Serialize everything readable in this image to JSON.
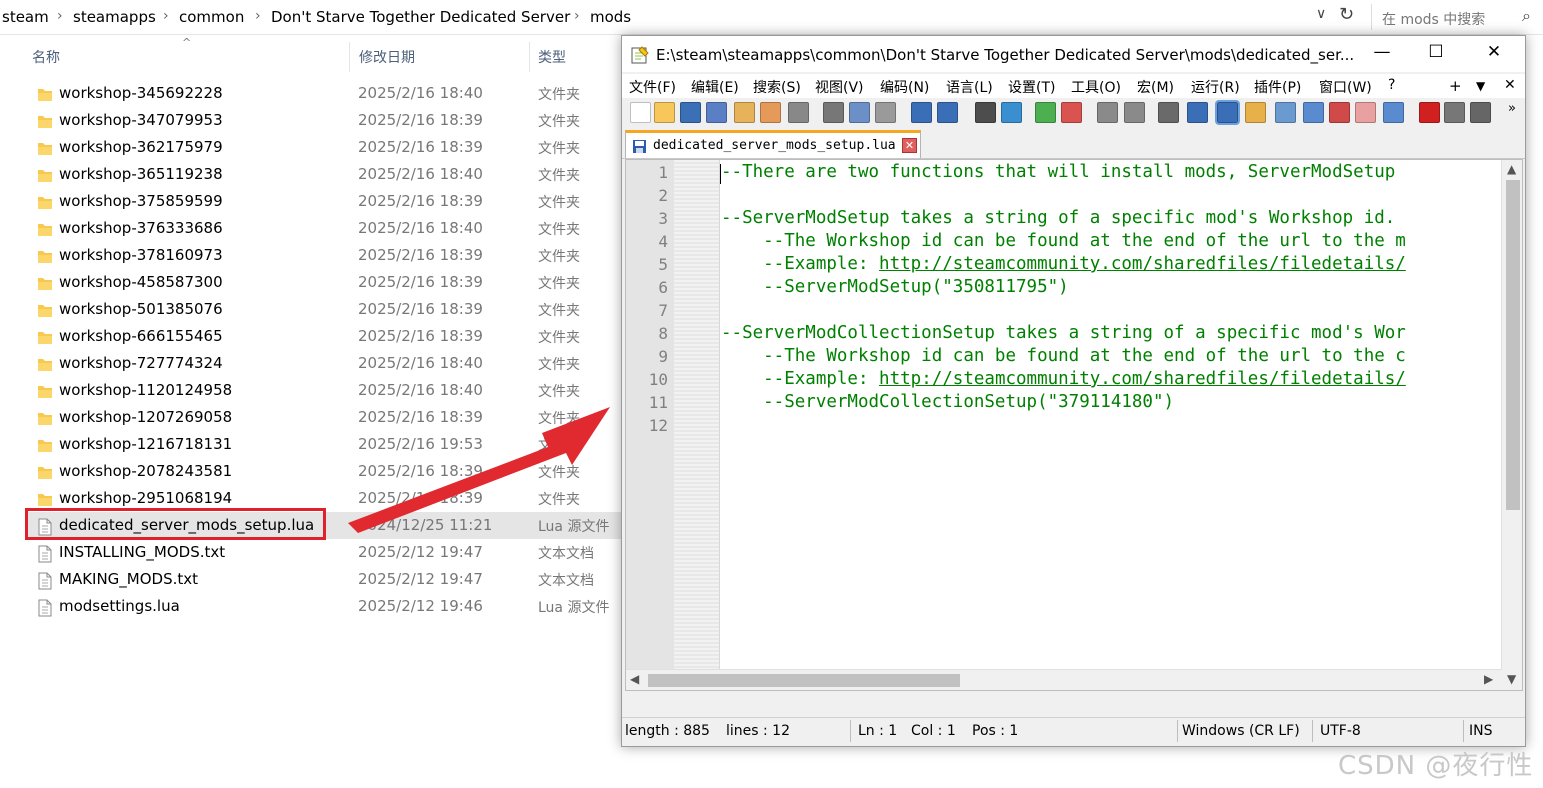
{
  "explorer": {
    "breadcrumb": [
      "steam",
      "steamapps",
      "common",
      "Don't Starve Together Dedicated Server",
      "mods"
    ],
    "search_placeholder": "在 mods 中搜索",
    "columns": {
      "name": "名称",
      "date": "修改日期",
      "type": "类型"
    },
    "files": [
      {
        "name": "workshop-345692228",
        "date": "2025/2/16 18:40",
        "type": "文件夹",
        "kind": "folder"
      },
      {
        "name": "workshop-347079953",
        "date": "2025/2/16 18:39",
        "type": "文件夹",
        "kind": "folder"
      },
      {
        "name": "workshop-362175979",
        "date": "2025/2/16 18:39",
        "type": "文件夹",
        "kind": "folder"
      },
      {
        "name": "workshop-365119238",
        "date": "2025/2/16 18:40",
        "type": "文件夹",
        "kind": "folder"
      },
      {
        "name": "workshop-375859599",
        "date": "2025/2/16 18:39",
        "type": "文件夹",
        "kind": "folder"
      },
      {
        "name": "workshop-376333686",
        "date": "2025/2/16 18:40",
        "type": "文件夹",
        "kind": "folder"
      },
      {
        "name": "workshop-378160973",
        "date": "2025/2/16 18:39",
        "type": "文件夹",
        "kind": "folder"
      },
      {
        "name": "workshop-458587300",
        "date": "2025/2/16 18:39",
        "type": "文件夹",
        "kind": "folder"
      },
      {
        "name": "workshop-501385076",
        "date": "2025/2/16 18:39",
        "type": "文件夹",
        "kind": "folder"
      },
      {
        "name": "workshop-666155465",
        "date": "2025/2/16 18:39",
        "type": "文件夹",
        "kind": "folder"
      },
      {
        "name": "workshop-727774324",
        "date": "2025/2/16 18:40",
        "type": "文件夹",
        "kind": "folder"
      },
      {
        "name": "workshop-1120124958",
        "date": "2025/2/16 18:40",
        "type": "文件夹",
        "kind": "folder"
      },
      {
        "name": "workshop-1207269058",
        "date": "2025/2/16 18:39",
        "type": "文件夹",
        "kind": "folder"
      },
      {
        "name": "workshop-1216718131",
        "date": "2025/2/16 19:53",
        "type": "文件夹",
        "kind": "folder"
      },
      {
        "name": "workshop-2078243581",
        "date": "2025/2/16 18:39",
        "type": "文件夹",
        "kind": "folder"
      },
      {
        "name": "workshop-2951068194",
        "date": "2025/2/16 18:39",
        "type": "文件夹",
        "kind": "folder"
      },
      {
        "name": "dedicated_server_mods_setup.lua",
        "date": "2024/12/25 11:21",
        "type": "Lua 源文件",
        "kind": "file"
      },
      {
        "name": "INSTALLING_MODS.txt",
        "date": "2025/2/12 19:47",
        "type": "文本文档",
        "kind": "file"
      },
      {
        "name": "MAKING_MODS.txt",
        "date": "2025/2/12 19:47",
        "type": "文本文档",
        "kind": "file"
      },
      {
        "name": "modsettings.lua",
        "date": "2025/2/12 19:46",
        "type": "Lua 源文件",
        "kind": "file"
      }
    ]
  },
  "npp": {
    "title": "E:\\steam\\steamapps\\common\\Don't Starve Together Dedicated Server\\mods\\dedicated_ser...",
    "menus": [
      "文件(F)",
      "编辑(E)",
      "搜索(S)",
      "视图(V)",
      "编码(N)",
      "语言(L)",
      "设置(T)",
      "工具(O)",
      "宏(M)",
      "运行(R)",
      "插件(P)",
      "窗口(W)",
      "?"
    ],
    "tab_label": "dedicated_server_mods_setup.lua",
    "line_numbers": [
      "1",
      "2",
      "3",
      "4",
      "5",
      "6",
      "7",
      "8",
      "9",
      "10",
      "11",
      "12"
    ],
    "code_lines": [
      "--There are two functions that will install mods, ServerModSetup",
      "",
      "--ServerModSetup takes a string of a specific mod's Workshop id.",
      "    --The Workshop id can be found at the end of the url to the m",
      "    --Example: ",
      "    --ServerModSetup(\"350811795\")",
      "",
      "--ServerModCollectionSetup takes a string of a specific mod's Wor",
      "    --The Workshop id can be found at the end of the url to the c",
      "    --Example: ",
      "    --ServerModCollectionSetup(\"379114180\")",
      ""
    ],
    "link_text": "http://steamcommunity.com/sharedfiles/filedetails/",
    "status": {
      "length": "length : 885",
      "lines": "lines : 12",
      "ln": "Ln : 1",
      "col": "Col : 1",
      "pos": "Pos : 1",
      "eol": "Windows (CR LF)",
      "encoding": "UTF-8",
      "mode": "INS"
    }
  },
  "watermark": "CSDN @夜行性",
  "colors": {
    "highlight": "#e0202a",
    "comment": "#008000",
    "tab_accent": "#f5a623"
  }
}
